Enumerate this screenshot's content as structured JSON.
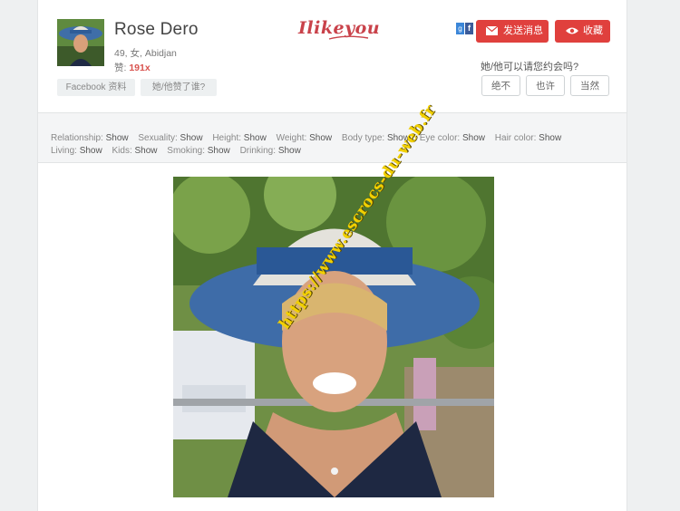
{
  "profile": {
    "name": "Rose Dero",
    "details": "49, 女, Abidjan",
    "likes_label": "赞:",
    "likes_count": "191x",
    "facebook_button": "Facebook 资料",
    "who_liked_button": "她/他赞了谁?"
  },
  "brand": {
    "logo_text": "Ilikeyou",
    "accent": "#c9424a"
  },
  "actions": {
    "message_label": "发送消息",
    "favorite_label": "收藏",
    "button_color": "#e0403d",
    "message_icon": "envelope-icon",
    "favorite_icon": "eye-icon"
  },
  "social": {
    "gplus": "g",
    "facebook": "f"
  },
  "date_question": {
    "prompt": "她/他可以请您约会吗?",
    "options": [
      "绝不",
      "也许",
      "当然"
    ]
  },
  "attributes": [
    {
      "label": "Relationship:",
      "value": "Show"
    },
    {
      "label": "Sexuality:",
      "value": "Show"
    },
    {
      "label": "Height:",
      "value": "Show"
    },
    {
      "label": "Weight:",
      "value": "Show"
    },
    {
      "label": "Body type:",
      "value": "Show"
    },
    {
      "label": "Eye color:",
      "value": "Show"
    },
    {
      "label": "Hair color:",
      "value": "Show"
    },
    {
      "label": "Living:",
      "value": "Show"
    },
    {
      "label": "Kids:",
      "value": "Show"
    },
    {
      "label": "Smoking:",
      "value": "Show"
    },
    {
      "label": "Drinking:",
      "value": "Show"
    }
  ],
  "photo": {
    "watermark": "https://www.escrocs-du-web.fr"
  }
}
